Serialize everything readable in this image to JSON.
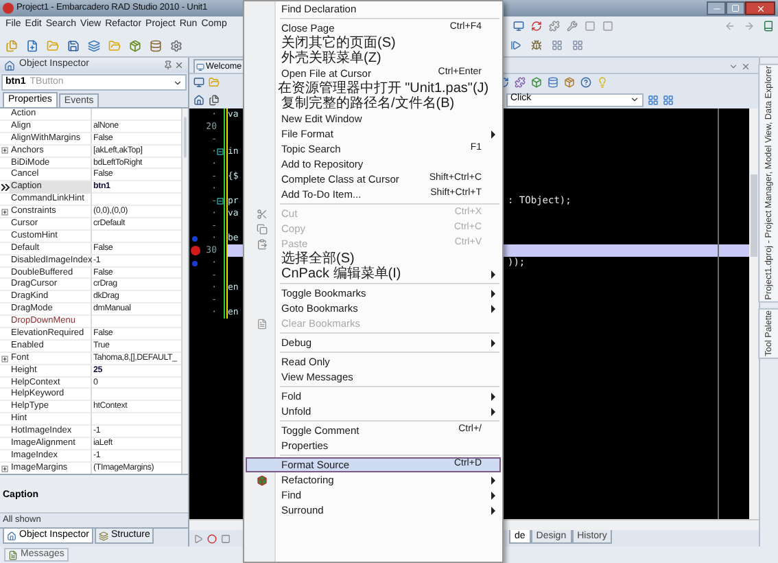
{
  "window": {
    "title": "Project1 - Embarcadero RAD Studio 2010 - Unit1"
  },
  "menubar": [
    "File",
    "Edit",
    "Search",
    "View",
    "Refactor",
    "Project",
    "Run",
    "Comp"
  ],
  "object_inspector": {
    "title": "Object Inspector",
    "component": {
      "name": "btn1",
      "type": "TButton"
    },
    "tabs": [
      {
        "label": "Properties",
        "selected": true
      },
      {
        "label": "Events",
        "selected": false
      }
    ],
    "properties": [
      {
        "name": "Action",
        "expandable": false,
        "selected": false
      },
      {
        "name": "Align",
        "value": "alNone",
        "expandable": false,
        "selected": false,
        "modified": false
      },
      {
        "name": "AlignWithMargins",
        "value": "False",
        "expandable": false,
        "selected": false,
        "modified": false
      },
      {
        "name": "Anchors",
        "value": "[akLeft,akTop]",
        "expandable": true,
        "selected": false,
        "modified": false
      },
      {
        "name": "BiDiMode",
        "value": "bdLeftToRight",
        "expandable": false,
        "selected": false,
        "modified": false
      },
      {
        "name": "Cancel",
        "value": "False",
        "expandable": false,
        "selected": false,
        "modified": false
      },
      {
        "name": "Caption",
        "value": "btn1",
        "expandable": false,
        "selected": true,
        "modified": true
      },
      {
        "name": "CommandLinkHint",
        "expandable": false,
        "selected": false
      },
      {
        "name": "Constraints",
        "value": "(0,0),(0,0)",
        "expandable": true,
        "selected": false,
        "modified": false
      },
      {
        "name": "Cursor",
        "value": "crDefault",
        "expandable": false,
        "selected": false,
        "modified": false
      },
      {
        "name": "CustomHint",
        "expandable": false,
        "selected": false
      },
      {
        "name": "Default",
        "value": "False",
        "expandable": false,
        "selected": false,
        "modified": false
      },
      {
        "name": "DisabledImageIndex",
        "value": "-1",
        "expandable": false,
        "selected": false,
        "modified": false
      },
      {
        "name": "DoubleBuffered",
        "value": "False",
        "expandable": false,
        "selected": false,
        "modified": false
      },
      {
        "name": "DragCursor",
        "value": "crDrag",
        "expandable": false,
        "selected": false,
        "modified": false
      },
      {
        "name": "DragKind",
        "value": "dkDrag",
        "expandable": false,
        "selected": false,
        "modified": false
      },
      {
        "name": "DragMode",
        "value": "dmManual",
        "expandable": false,
        "selected": false,
        "modified": false
      },
      {
        "name": "DropDownMenu",
        "expandable": false,
        "selected": false,
        "color": "#8b2c2c"
      },
      {
        "name": "ElevationRequired",
        "value": "False",
        "expandable": false,
        "selected": false,
        "modified": false
      },
      {
        "name": "Enabled",
        "value": "True",
        "expandable": false,
        "selected": false,
        "modified": false
      },
      {
        "name": "Font",
        "value": "Tahoma,8,[],DEFAULT_",
        "expandable": true,
        "selected": false,
        "modified": false
      },
      {
        "name": "Height",
        "value": "25",
        "expandable": false,
        "selected": false,
        "modified": true
      },
      {
        "name": "HelpContext",
        "value": "0",
        "expandable": false,
        "selected": false,
        "modified": false
      },
      {
        "name": "HelpKeyword",
        "expandable": false,
        "selected": false
      },
      {
        "name": "HelpType",
        "value": "htContext",
        "expandable": false,
        "selected": false,
        "modified": false
      },
      {
        "name": "Hint",
        "expandable": false,
        "selected": false
      },
      {
        "name": "HotImageIndex",
        "value": "-1",
        "expandable": false,
        "selected": false,
        "modified": false
      },
      {
        "name": "ImageAlignment",
        "value": "iaLeft",
        "expandable": false,
        "selected": false,
        "modified": false
      },
      {
        "name": "ImageIndex",
        "value": "-1",
        "expandable": false,
        "selected": false,
        "modified": false
      },
      {
        "name": "ImageMargins",
        "value": "(TImageMargins)",
        "expandable": true,
        "selected": false,
        "modified": false
      }
    ],
    "description_title": "Caption",
    "status": "All shown"
  },
  "dock_tabs": [
    {
      "label": "Object Inspector",
      "selected": true
    },
    {
      "label": "Structure",
      "selected": false
    }
  ],
  "messages_tab": "Messages",
  "editor": {
    "tabs": [
      {
        "label": "Welcome",
        "selected": false
      }
    ],
    "event_combo": "Click",
    "lines": [
      {
        "kind": "plain",
        "gutter": "·",
        "text": "va",
        "fold": false,
        "highlighted": false
      },
      {
        "kind": "plain",
        "gutter": "20",
        "fold": false,
        "highlighted": false
      },
      {
        "kind": "plain",
        "gutter": "-",
        "fold": false,
        "highlighted": false
      },
      {
        "kind": "plain",
        "gutter": "·",
        "text": "in",
        "fold": true,
        "highlighted": false
      },
      {
        "kind": "plain",
        "gutter": "·",
        "fold": false,
        "highlighted": false
      },
      {
        "kind": "plain",
        "gutter": "-",
        "text": "{$",
        "fold": false,
        "highlighted": false
      },
      {
        "kind": "plain",
        "gutter": "·",
        "fold": false,
        "highlighted": false
      },
      {
        "kind": "plain",
        "gutter": "-",
        "text": "pr",
        "right_text": ": TObject);",
        "fold": true,
        "highlighted": false
      },
      {
        "kind": "plain",
        "gutter": "·",
        "text": "va",
        "fold": false,
        "highlighted": false
      },
      {
        "kind": "plain",
        "gutter": "-",
        "fold": false,
        "highlighted": false
      },
      {
        "kind": "dot",
        "gutter": "·",
        "text": "be",
        "fold": false,
        "highlighted": false
      },
      {
        "kind": "breakpoint",
        "gutter": "30",
        "fold": false,
        "highlighted": true
      },
      {
        "kind": "dot",
        "gutter": "·",
        "right_text": "));",
        "fold": false,
        "highlighted": false
      },
      {
        "kind": "plain",
        "gutter": "-",
        "fold": false,
        "highlighted": false
      },
      {
        "kind": "plain",
        "gutter": "·",
        "text": "en",
        "fold": false,
        "highlighted": false
      },
      {
        "kind": "plain",
        "gutter": "-",
        "fold": false,
        "highlighted": false
      },
      {
        "kind": "plain",
        "gutter": "·",
        "text": "en",
        "fold": false,
        "highlighted": false
      }
    ],
    "view_tabs": [
      {
        "label": "de",
        "selected": true
      },
      {
        "label": "Design",
        "selected": false
      },
      {
        "label": "History",
        "selected": false
      }
    ]
  },
  "dock_strip": [
    "Project1.dproj - Project Manager, Model View, Data Explorer",
    "Tool Palette"
  ],
  "context_menu": [
    {
      "kind": "item",
      "label": "Find Declaration",
      "disabled": false,
      "selected": false,
      "submenu": false
    },
    {
      "kind": "separator"
    },
    {
      "kind": "item",
      "label": "Close Page",
      "shortcut": "Ctrl+F4",
      "disabled": false,
      "selected": false,
      "submenu": false
    },
    {
      "kind": "item",
      "label": "关闭其它的页面(S)",
      "disabled": false,
      "selected": false,
      "submenu": false
    },
    {
      "kind": "item",
      "label": "外壳关联菜单(Z)",
      "disabled": false,
      "selected": false,
      "submenu": false
    },
    {
      "kind": "item",
      "label": "Open File at Cursor",
      "shortcut": "Ctrl+Enter",
      "disabled": false,
      "selected": false,
      "submenu": false
    },
    {
      "kind": "item",
      "label": "在资源管理器中打开 \"Unit1.pas\"(J)",
      "disabled": false,
      "selected": false,
      "submenu": false
    },
    {
      "kind": "item",
      "label": "复制完整的路径名/文件名(B)",
      "disabled": false,
      "selected": false,
      "submenu": false
    },
    {
      "kind": "item",
      "label": "New Edit Window",
      "disabled": false,
      "selected": false,
      "submenu": false
    },
    {
      "kind": "item",
      "label": "File Format",
      "disabled": false,
      "selected": false,
      "submenu": true
    },
    {
      "kind": "item",
      "label": "Topic Search",
      "shortcut": "F1",
      "disabled": false,
      "selected": false,
      "submenu": false
    },
    {
      "kind": "item",
      "label": "Add to Repository",
      "disabled": false,
      "selected": false,
      "submenu": false
    },
    {
      "kind": "item",
      "label": "Complete Class at Cursor",
      "shortcut": "Shift+Ctrl+C",
      "disabled": false,
      "selected": false,
      "submenu": false
    },
    {
      "kind": "item",
      "label": "Add To-Do Item...",
      "shortcut": "Shift+Ctrl+T",
      "disabled": false,
      "selected": false,
      "submenu": false
    },
    {
      "kind": "separator"
    },
    {
      "kind": "scissors",
      "label": "Cut",
      "shortcut": "Ctrl+X",
      "disabled": true,
      "selected": false,
      "submenu": false
    },
    {
      "kind": "copy",
      "label": "Copy",
      "shortcut": "Ctrl+C",
      "disabled": true,
      "selected": false,
      "submenu": false
    },
    {
      "kind": "paste",
      "label": "Paste",
      "shortcut": "Ctrl+V",
      "disabled": true,
      "selected": false,
      "submenu": false
    },
    {
      "kind": "item",
      "label": "选择全部(S)",
      "disabled": false,
      "selected": false,
      "submenu": false
    },
    {
      "kind": "item",
      "label": "CnPack 编辑菜单(I)",
      "disabled": false,
      "selected": false,
      "submenu": true
    },
    {
      "kind": "separator"
    },
    {
      "kind": "item",
      "label": "Toggle Bookmarks",
      "disabled": false,
      "selected": false,
      "submenu": true
    },
    {
      "kind": "item",
      "label": "Goto Bookmarks",
      "disabled": false,
      "selected": false,
      "submenu": true
    },
    {
      "kind": "document",
      "label": "Clear Bookmarks",
      "disabled": true,
      "selected": false,
      "submenu": false
    },
    {
      "kind": "separator"
    },
    {
      "kind": "item",
      "label": "Debug",
      "disabled": false,
      "selected": false,
      "submenu": true
    },
    {
      "kind": "separator"
    },
    {
      "kind": "item",
      "label": "Read Only",
      "disabled": false,
      "selected": false,
      "submenu": false
    },
    {
      "kind": "item",
      "label": "View Messages",
      "disabled": false,
      "selected": false,
      "submenu": false
    },
    {
      "kind": "separator"
    },
    {
      "kind": "item",
      "label": "Fold",
      "disabled": false,
      "selected": false,
      "submenu": true
    },
    {
      "kind": "item",
      "label": "Unfold",
      "disabled": false,
      "selected": false,
      "submenu": true
    },
    {
      "kind": "separator"
    },
    {
      "kind": "item",
      "label": "Toggle Comment",
      "shortcut": "Ctrl+/",
      "disabled": false,
      "selected": false,
      "submenu": false
    },
    {
      "kind": "item",
      "label": "Properties",
      "disabled": false,
      "selected": false,
      "submenu": false
    },
    {
      "kind": "separator"
    },
    {
      "kind": "item",
      "label": "Format Source",
      "shortcut": "Ctrl+D",
      "disabled": false,
      "selected": true,
      "submenu": false
    },
    {
      "kind": "cube",
      "label": "Refactoring",
      "disabled": false,
      "selected": false,
      "submenu": true
    },
    {
      "kind": "item",
      "label": "Find",
      "disabled": false,
      "selected": false,
      "submenu": true
    },
    {
      "kind": "item",
      "label": "Surround",
      "disabled": false,
      "selected": false,
      "submenu": true
    }
  ]
}
